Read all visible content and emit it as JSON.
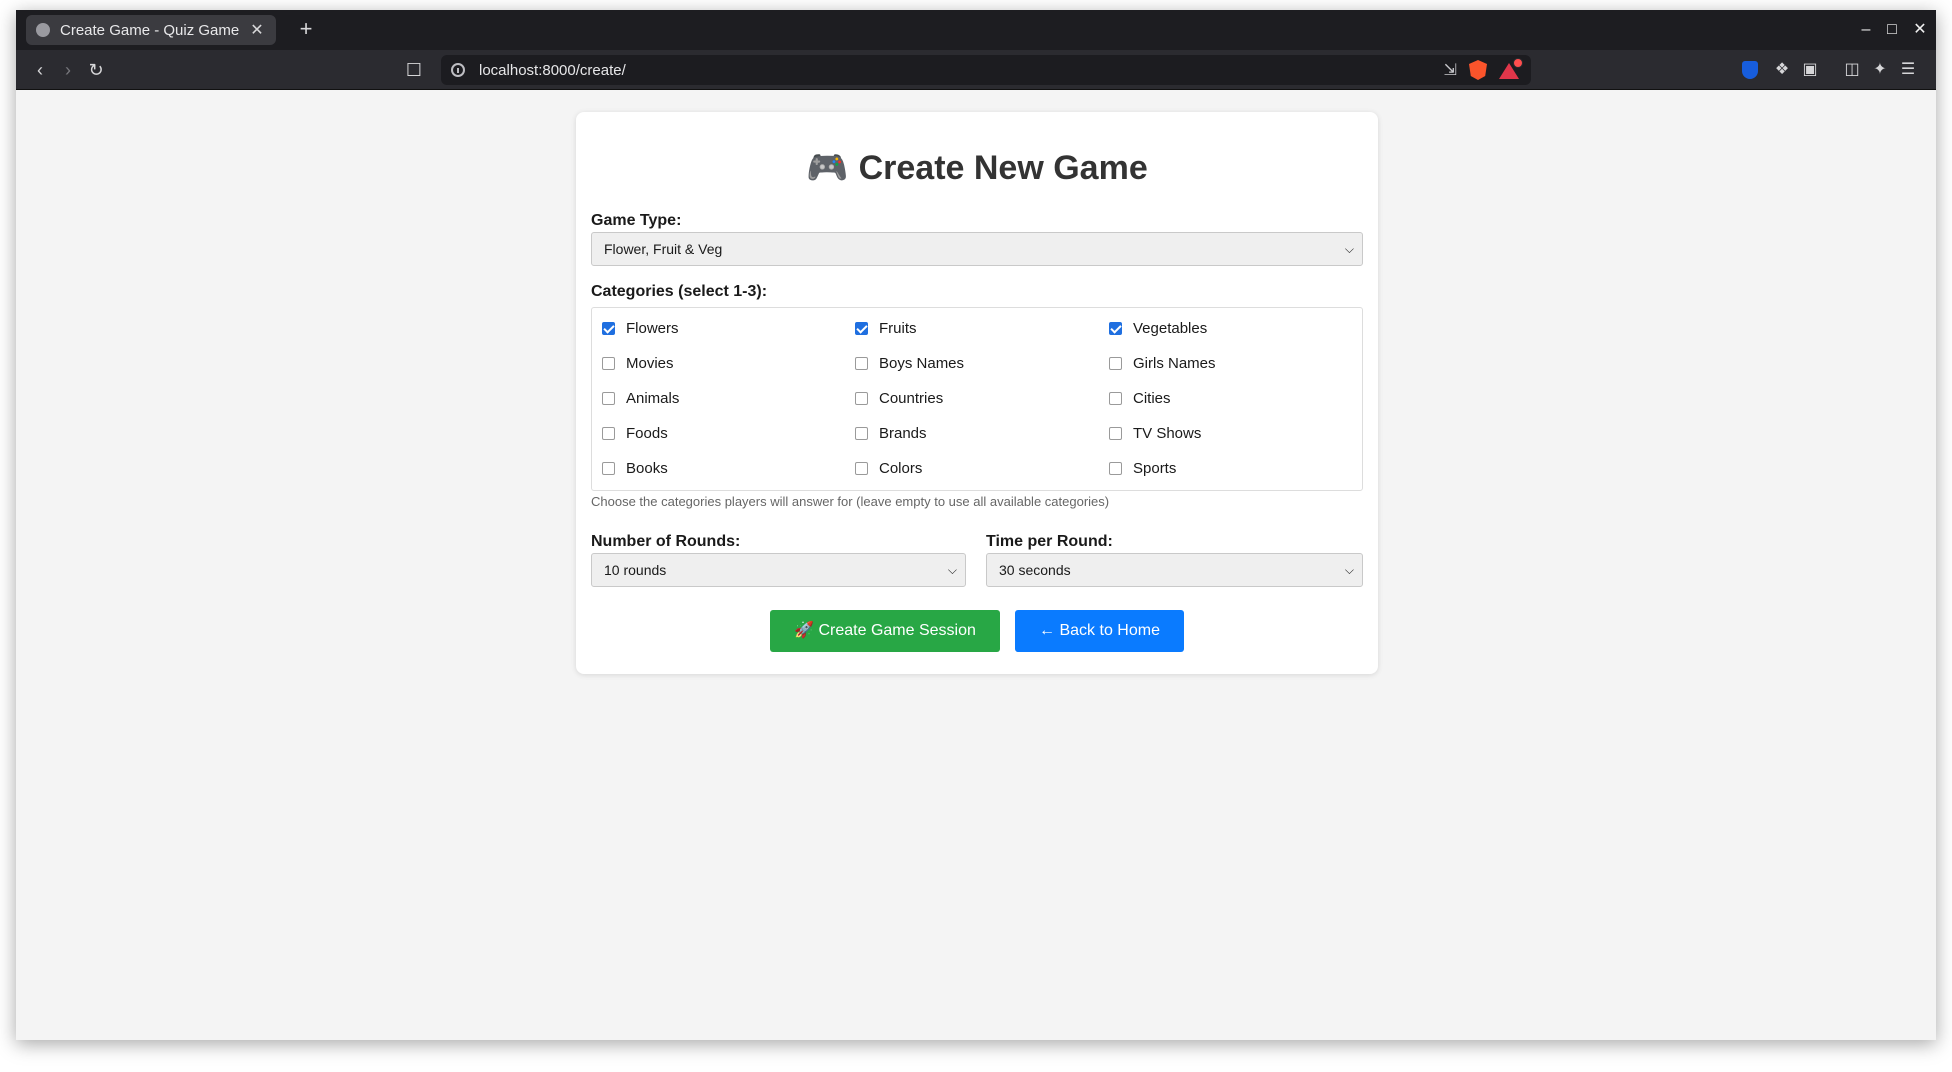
{
  "browser": {
    "tab_title": "Create Game - Quiz Game",
    "new_tab": "+",
    "tab_close": "✕",
    "url": "localhost:8000/create/",
    "minimize": "–",
    "maximize": "□",
    "close": "✕"
  },
  "page": {
    "heading_icon": "🎮",
    "heading": "Create New Game",
    "game_type_label": "Game Type:",
    "game_type_value": "Flower, Fruit & Veg",
    "categories_label": "Categories (select 1-3):",
    "categories": [
      {
        "label": "Flowers",
        "checked": true
      },
      {
        "label": "Fruits",
        "checked": true
      },
      {
        "label": "Vegetables",
        "checked": true
      },
      {
        "label": "Movies",
        "checked": false
      },
      {
        "label": "Boys Names",
        "checked": false
      },
      {
        "label": "Girls Names",
        "checked": false
      },
      {
        "label": "Animals",
        "checked": false
      },
      {
        "label": "Countries",
        "checked": false
      },
      {
        "label": "Cities",
        "checked": false
      },
      {
        "label": "Foods",
        "checked": false
      },
      {
        "label": "Brands",
        "checked": false
      },
      {
        "label": "TV Shows",
        "checked": false
      },
      {
        "label": "Books",
        "checked": false
      },
      {
        "label": "Colors",
        "checked": false
      },
      {
        "label": "Sports",
        "checked": false
      }
    ],
    "categories_help": "Choose the categories players will answer for (leave empty to use all available categories)",
    "rounds_label": "Number of Rounds:",
    "rounds_value": "10 rounds",
    "time_label": "Time per Round:",
    "time_value": "30 seconds",
    "create_button": "🚀 Create Game Session",
    "back_button": "← Back to Home"
  },
  "colors": {
    "primary_green": "#28a745",
    "primary_blue": "#0a7bff",
    "checkbox_blue": "#1f6fe0"
  }
}
